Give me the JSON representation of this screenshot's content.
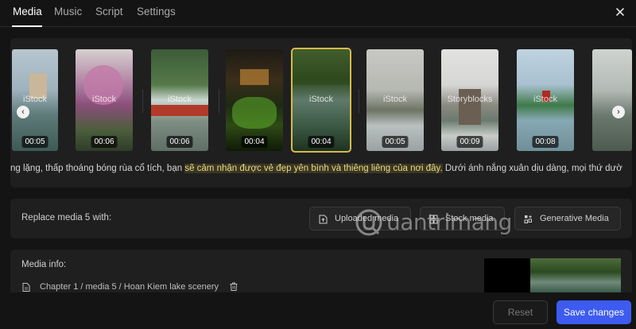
{
  "tabs": [
    {
      "label": "Media",
      "active": true
    },
    {
      "label": "Music",
      "active": false
    },
    {
      "label": "Script",
      "active": false
    },
    {
      "label": "Settings",
      "active": false
    }
  ],
  "media_strip": {
    "items": [
      {
        "duration": "00:05",
        "watermark": "iStock",
        "selected": false
      },
      {
        "duration": "00:06",
        "watermark": "iStock",
        "selected": false
      },
      {
        "duration": "00:06",
        "watermark": "iStock",
        "selected": false
      },
      {
        "duration": "00:04",
        "watermark": "",
        "selected": false
      },
      {
        "duration": "00:04",
        "watermark": "iStock",
        "selected": true
      },
      {
        "duration": "00:05",
        "watermark": "iStock",
        "selected": false
      },
      {
        "duration": "00:09",
        "watermark": "Storyblocks",
        "selected": false
      },
      {
        "duration": "00:08",
        "watermark": "iStock",
        "selected": false
      },
      {
        "duration": "",
        "watermark": "",
        "selected": false
      }
    ],
    "prev_icon": "chevron-left-icon",
    "next_icon": "chevron-right-icon"
  },
  "script": {
    "before": "ng lặng, thấp thoáng bóng rùa cổ tích, bạn ",
    "highlight": "sẽ cảm nhận được vẻ đẹp yên bình và thiêng liêng của nơi đây.",
    "after": " Dưới ánh nắng xuân dịu dàng, mọi thứ dườ"
  },
  "replace": {
    "label": "Replace media 5 with:",
    "buttons": [
      {
        "label": "Uploaded media",
        "icon": "file-upload-icon"
      },
      {
        "label": "Stock media",
        "icon": "stock-icon"
      },
      {
        "label": "Generative Media",
        "icon": "sparkle-grid-icon"
      }
    ]
  },
  "info": {
    "title": "Media info:",
    "path": "Chapter 1 / media 5 / Hoan Kiem lake scenery"
  },
  "footer": {
    "reset_label": "Reset",
    "save_label": "Save changes"
  },
  "watermark_logo": "uantrimang",
  "colors": {
    "accent": "#3d5bf0",
    "selected_outline": "#d8b94a",
    "highlight_text": "#e9d98a"
  }
}
